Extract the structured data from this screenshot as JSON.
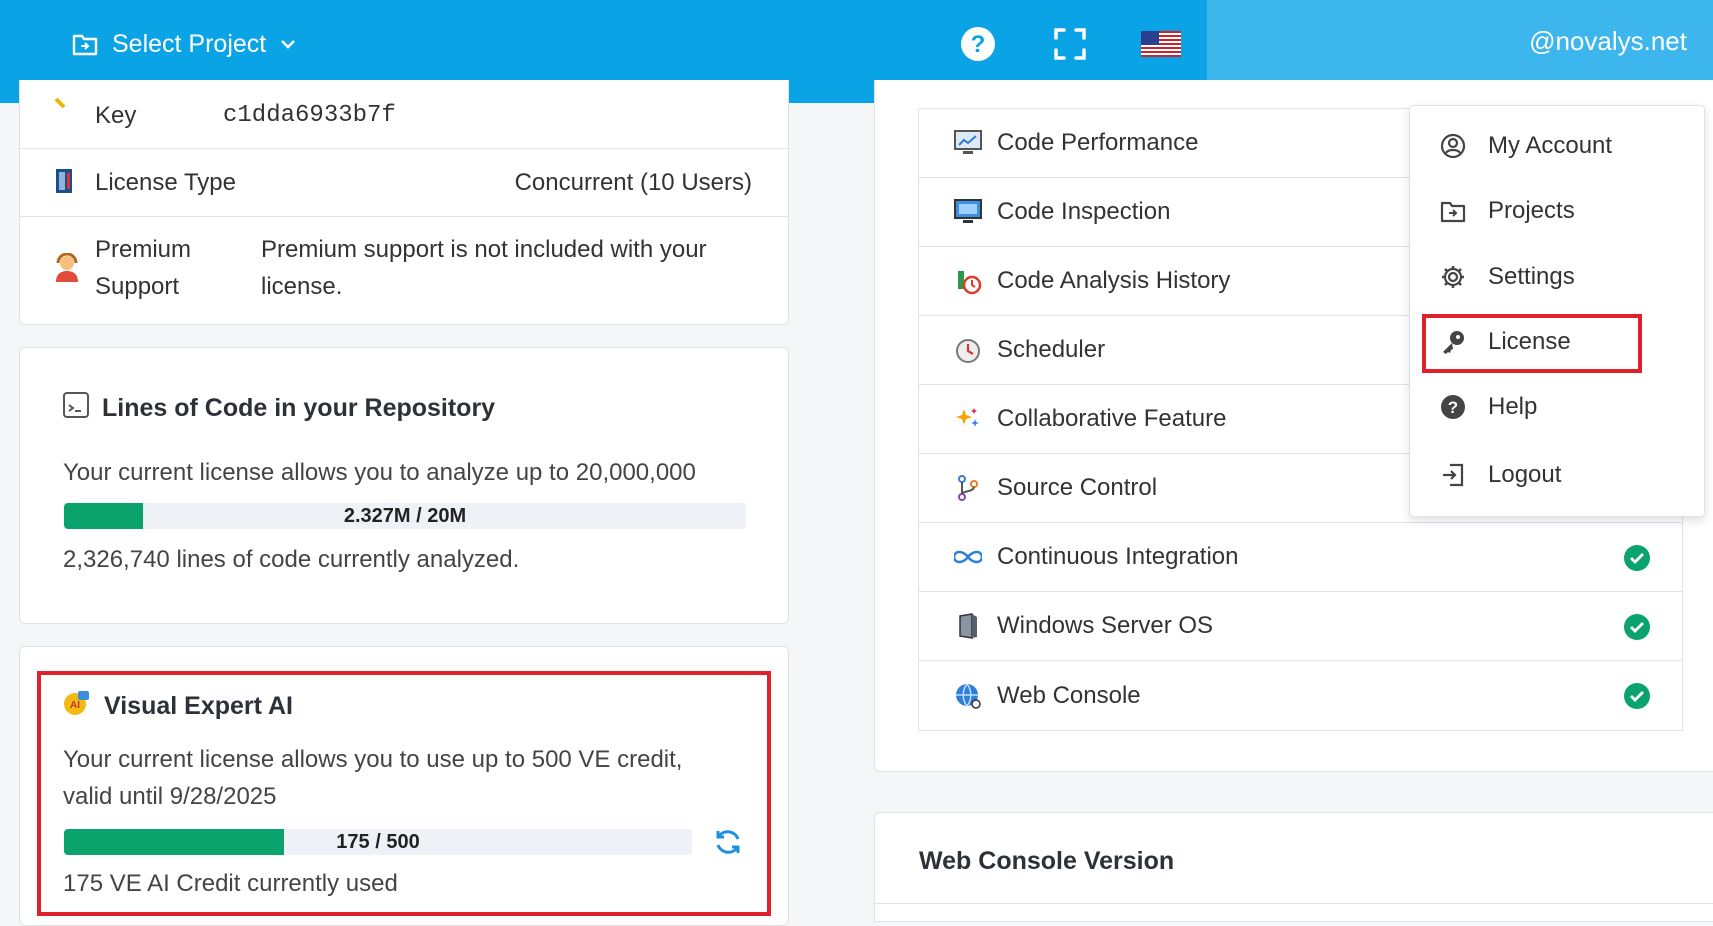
{
  "header": {
    "select_project_label": "Select Project",
    "user": "@novalys.net",
    "help_icon": "help-icon",
    "fullscreen_icon": "fullscreen-icon",
    "flag_icon": "us-flag-icon"
  },
  "license_info": {
    "key_label": "Key",
    "key_value": "c1dda6933b7f",
    "type_label": "License Type",
    "type_value": "Concurrent (10 Users)",
    "premium_label_line1": "Premium",
    "premium_label_line2": "Support",
    "premium_value_line1": "Premium support is not included with your",
    "premium_value_line2": "license."
  },
  "loc": {
    "title": "Lines of Code in your Repository",
    "description": "Your current license allows you to analyze up to 20,000,000",
    "progress_label": "2.327M / 20M",
    "progress_fraction": 0.1163,
    "analyzed_text": "2,326,740 lines of code currently analyzed."
  },
  "ai": {
    "title": "Visual Expert AI",
    "description_line1": "Your current license allows you to use up to 500 VE credit,",
    "description_line2": "valid until 9/28/2025",
    "progress_label": "175 / 500",
    "progress_fraction": 0.35,
    "used_text": "175 VE AI Credit currently used",
    "refresh_icon": "refresh-icon"
  },
  "features": [
    {
      "label": "Code Performance",
      "icon": "chart-monitor-icon",
      "checked": false
    },
    {
      "label": "Code Inspection",
      "icon": "monitor-icon",
      "checked": false
    },
    {
      "label": "Code Analysis History",
      "icon": "history-icon",
      "checked": false
    },
    {
      "label": "Scheduler",
      "icon": "scheduler-icon",
      "checked": false
    },
    {
      "label": "Collaborative Feature",
      "icon": "sparkle-icon",
      "checked": false
    },
    {
      "label": "Source Control",
      "icon": "branch-icon",
      "checked": false
    },
    {
      "label": "Continuous Integration",
      "icon": "infinity-icon",
      "checked": true
    },
    {
      "label": "Windows Server OS",
      "icon": "server-icon",
      "checked": true
    },
    {
      "label": "Web Console",
      "icon": "globe-icon",
      "checked": true
    }
  ],
  "version_card": {
    "title": "Web Console Version"
  },
  "user_menu": {
    "items": [
      {
        "label": "My Account",
        "icon": "account-icon"
      },
      {
        "label": "Projects",
        "icon": "folder-icon"
      },
      {
        "label": "Settings",
        "icon": "gear-icon"
      },
      {
        "label": "License",
        "icon": "key-icon"
      },
      {
        "label": "Help",
        "icon": "help-circle-icon"
      },
      {
        "label": "Logout",
        "icon": "logout-icon"
      }
    ]
  },
  "colors": {
    "topbar": "#0aa3e6",
    "progress": "#0ba36d",
    "highlight": "#e0202a"
  }
}
